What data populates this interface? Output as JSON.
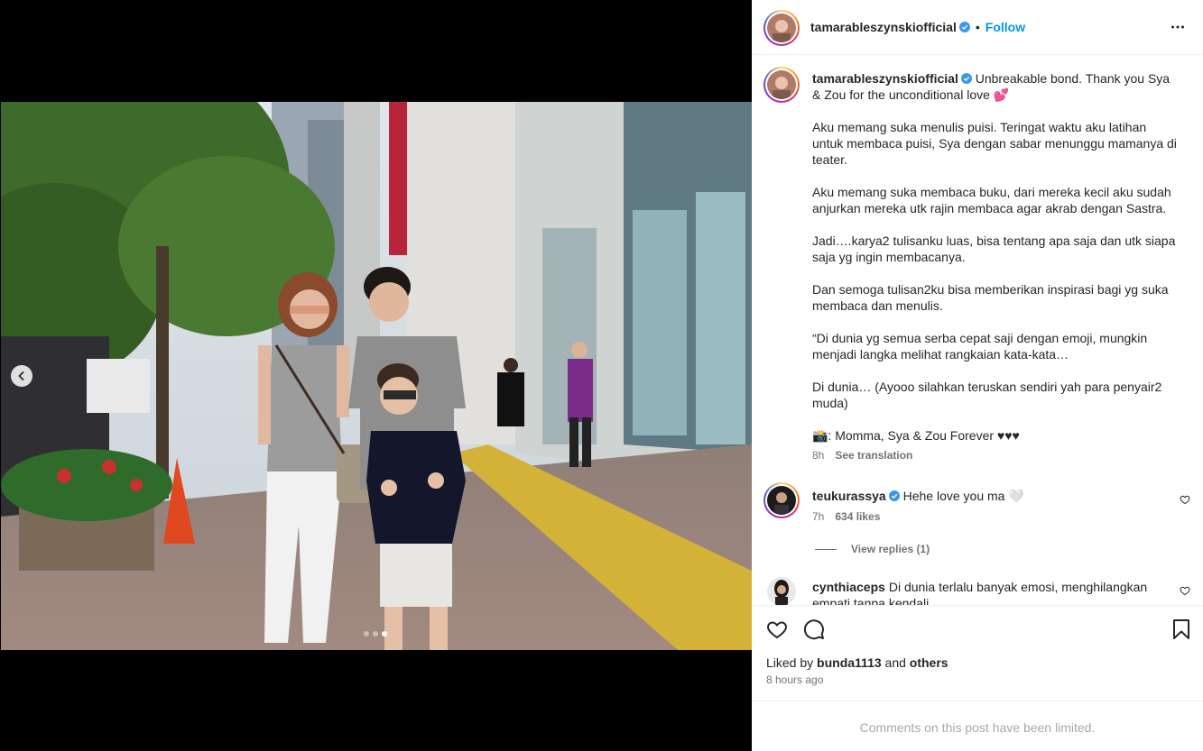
{
  "post": {
    "username": "tamarableszynskiofficial",
    "follow_label": "Follow",
    "separator": "•"
  },
  "caption": {
    "username": "tamarableszynskiofficial",
    "paragraphs": [
      "Unbreakable bond. Thank you Sya & Zou for the unconditional love 💕",
      "Aku memang suka menulis puisi. Teringat waktu aku latihan untuk membaca puisi, Sya dengan sabar menunggu mamanya di teater.",
      "Aku memang suka membaca buku, dari mereka kecil aku sudah anjurkan mereka utk rajin membaca agar akrab dengan Sastra.",
      "Jadi….karya2 tulisanku luas, bisa tentang apa saja dan utk siapa saja yg ingin membacanya.",
      "Dan semoga tulisan2ku bisa memberikan inspirasi bagi yg suka membaca dan menulis.",
      "“Di dunia yg semua serba cepat saji dengan emoji, mungkin menjadi langka melihat rangkaian kata-kata…",
      "Di dunia… (Ayooo silahkan teruskan sendiri yah para penyair2 muda)",
      "📸: Momma, Sya & Zou Forever ♥♥♥"
    ],
    "time": "8h",
    "see_translation": "See translation"
  },
  "comments": [
    {
      "username": "teukurassya",
      "text": "Hehe love you ma 🤍",
      "time": "7h",
      "likes": "634 likes",
      "view_replies": "View replies (1)"
    },
    {
      "username": "cynthiaceps",
      "text": "Di dunia terlalu banyak emosi, menghilangkan empati tanpa kendali"
    }
  ],
  "footer": {
    "liked_by_prefix": "Liked by",
    "liked_by_user": "bunda1113",
    "liked_by_and": "and",
    "liked_by_others": "others",
    "time_ago": "8 hours ago",
    "comments_limited": "Comments on this post have been limited."
  },
  "carousel": {
    "total": 3,
    "active_index": 2
  },
  "colors": {
    "accent": "#0095f6",
    "verified": "#3897f0",
    "muted": "#737373"
  },
  "icons": [
    "chevron-left-icon",
    "verified-icon",
    "more-icon",
    "heart-icon",
    "comment-icon",
    "bookmark-icon"
  ]
}
